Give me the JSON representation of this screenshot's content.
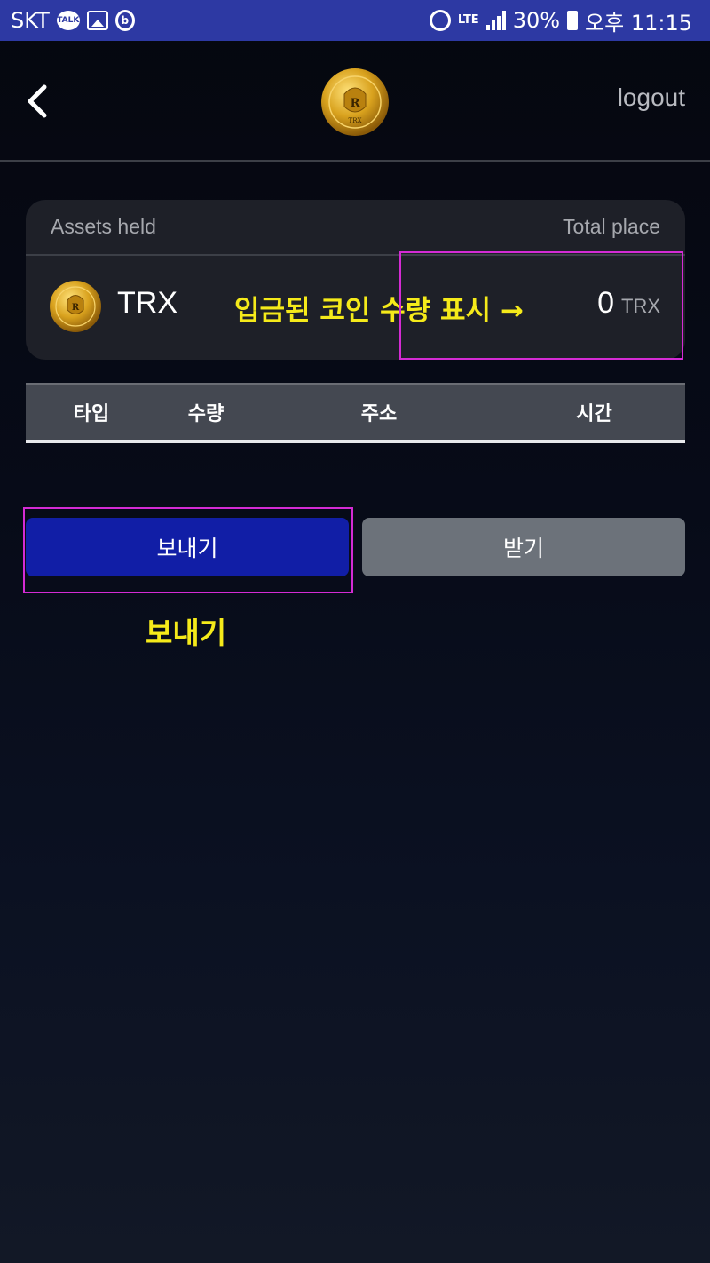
{
  "status_bar": {
    "carrier": "SKT",
    "talk_badge": "TALK",
    "b_badge": "b",
    "lte": "LTE",
    "battery": "30%",
    "time": "오후 11:15",
    "icons": [
      "kakaotalk-icon",
      "gallery-icon",
      "b-app-icon",
      "alarm-icon",
      "lte-icon",
      "signal-icon",
      "battery-icon"
    ]
  },
  "header": {
    "back_icon": "chevron-left-icon",
    "logo_letter": "R",
    "logo_sub": "TRX",
    "logout_label": "logout"
  },
  "asset_card": {
    "held_label": "Assets held",
    "total_label": "Total place",
    "coin": {
      "name": "TRX",
      "amount": "0",
      "unit": "TRX"
    }
  },
  "annotations": {
    "deposit_note": "입금된 코인 수량 표시 →",
    "send_note": "보내기",
    "highlight_color": "#d42bd4",
    "text_color": "#f5ea1a"
  },
  "table": {
    "columns": [
      "타입",
      "수량",
      "주소",
      "시간"
    ]
  },
  "actions": {
    "send_label": "보내기",
    "receive_label": "받기",
    "send_color": "#111ea6",
    "receive_color": "#6c727a"
  }
}
